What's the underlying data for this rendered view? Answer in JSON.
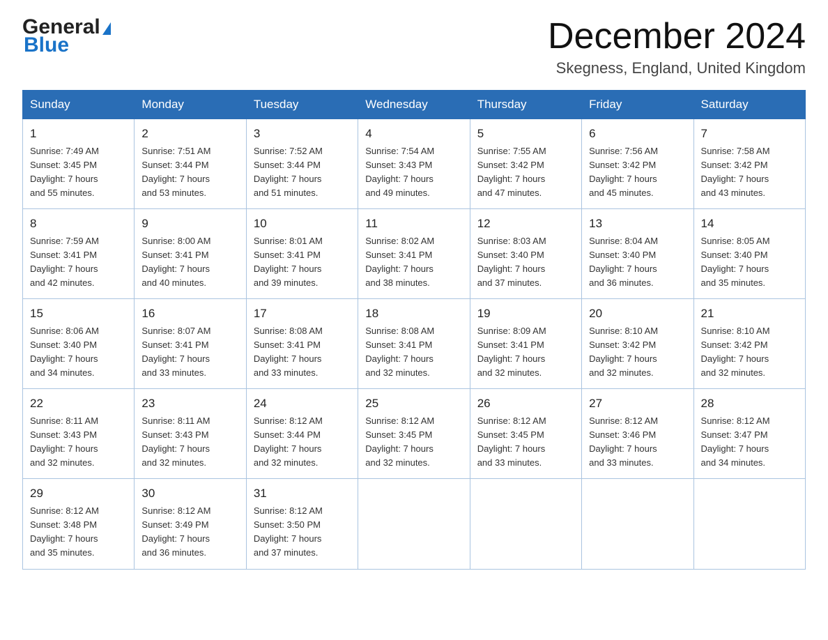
{
  "header": {
    "logo_general": "General",
    "logo_blue": "Blue",
    "title": "December 2024",
    "subtitle": "Skegness, England, United Kingdom"
  },
  "days_of_week": [
    "Sunday",
    "Monday",
    "Tuesday",
    "Wednesday",
    "Thursday",
    "Friday",
    "Saturday"
  ],
  "weeks": [
    [
      {
        "num": "1",
        "sunrise": "7:49 AM",
        "sunset": "3:45 PM",
        "daylight": "7 hours and 55 minutes."
      },
      {
        "num": "2",
        "sunrise": "7:51 AM",
        "sunset": "3:44 PM",
        "daylight": "7 hours and 53 minutes."
      },
      {
        "num": "3",
        "sunrise": "7:52 AM",
        "sunset": "3:44 PM",
        "daylight": "7 hours and 51 minutes."
      },
      {
        "num": "4",
        "sunrise": "7:54 AM",
        "sunset": "3:43 PM",
        "daylight": "7 hours and 49 minutes."
      },
      {
        "num": "5",
        "sunrise": "7:55 AM",
        "sunset": "3:42 PM",
        "daylight": "7 hours and 47 minutes."
      },
      {
        "num": "6",
        "sunrise": "7:56 AM",
        "sunset": "3:42 PM",
        "daylight": "7 hours and 45 minutes."
      },
      {
        "num": "7",
        "sunrise": "7:58 AM",
        "sunset": "3:42 PM",
        "daylight": "7 hours and 43 minutes."
      }
    ],
    [
      {
        "num": "8",
        "sunrise": "7:59 AM",
        "sunset": "3:41 PM",
        "daylight": "7 hours and 42 minutes."
      },
      {
        "num": "9",
        "sunrise": "8:00 AM",
        "sunset": "3:41 PM",
        "daylight": "7 hours and 40 minutes."
      },
      {
        "num": "10",
        "sunrise": "8:01 AM",
        "sunset": "3:41 PM",
        "daylight": "7 hours and 39 minutes."
      },
      {
        "num": "11",
        "sunrise": "8:02 AM",
        "sunset": "3:41 PM",
        "daylight": "7 hours and 38 minutes."
      },
      {
        "num": "12",
        "sunrise": "8:03 AM",
        "sunset": "3:40 PM",
        "daylight": "7 hours and 37 minutes."
      },
      {
        "num": "13",
        "sunrise": "8:04 AM",
        "sunset": "3:40 PM",
        "daylight": "7 hours and 36 minutes."
      },
      {
        "num": "14",
        "sunrise": "8:05 AM",
        "sunset": "3:40 PM",
        "daylight": "7 hours and 35 minutes."
      }
    ],
    [
      {
        "num": "15",
        "sunrise": "8:06 AM",
        "sunset": "3:40 PM",
        "daylight": "7 hours and 34 minutes."
      },
      {
        "num": "16",
        "sunrise": "8:07 AM",
        "sunset": "3:41 PM",
        "daylight": "7 hours and 33 minutes."
      },
      {
        "num": "17",
        "sunrise": "8:08 AM",
        "sunset": "3:41 PM",
        "daylight": "7 hours and 33 minutes."
      },
      {
        "num": "18",
        "sunrise": "8:08 AM",
        "sunset": "3:41 PM",
        "daylight": "7 hours and 32 minutes."
      },
      {
        "num": "19",
        "sunrise": "8:09 AM",
        "sunset": "3:41 PM",
        "daylight": "7 hours and 32 minutes."
      },
      {
        "num": "20",
        "sunrise": "8:10 AM",
        "sunset": "3:42 PM",
        "daylight": "7 hours and 32 minutes."
      },
      {
        "num": "21",
        "sunrise": "8:10 AM",
        "sunset": "3:42 PM",
        "daylight": "7 hours and 32 minutes."
      }
    ],
    [
      {
        "num": "22",
        "sunrise": "8:11 AM",
        "sunset": "3:43 PM",
        "daylight": "7 hours and 32 minutes."
      },
      {
        "num": "23",
        "sunrise": "8:11 AM",
        "sunset": "3:43 PM",
        "daylight": "7 hours and 32 minutes."
      },
      {
        "num": "24",
        "sunrise": "8:12 AM",
        "sunset": "3:44 PM",
        "daylight": "7 hours and 32 minutes."
      },
      {
        "num": "25",
        "sunrise": "8:12 AM",
        "sunset": "3:45 PM",
        "daylight": "7 hours and 32 minutes."
      },
      {
        "num": "26",
        "sunrise": "8:12 AM",
        "sunset": "3:45 PM",
        "daylight": "7 hours and 33 minutes."
      },
      {
        "num": "27",
        "sunrise": "8:12 AM",
        "sunset": "3:46 PM",
        "daylight": "7 hours and 33 minutes."
      },
      {
        "num": "28",
        "sunrise": "8:12 AM",
        "sunset": "3:47 PM",
        "daylight": "7 hours and 34 minutes."
      }
    ],
    [
      {
        "num": "29",
        "sunrise": "8:12 AM",
        "sunset": "3:48 PM",
        "daylight": "7 hours and 35 minutes."
      },
      {
        "num": "30",
        "sunrise": "8:12 AM",
        "sunset": "3:49 PM",
        "daylight": "7 hours and 36 minutes."
      },
      {
        "num": "31",
        "sunrise": "8:12 AM",
        "sunset": "3:50 PM",
        "daylight": "7 hours and 37 minutes."
      },
      null,
      null,
      null,
      null
    ]
  ]
}
